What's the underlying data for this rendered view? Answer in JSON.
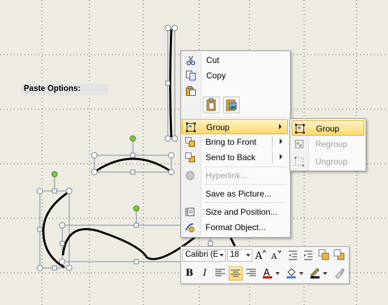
{
  "context_menu": {
    "items": [
      {
        "label": "Cut",
        "icon": "scissors-icon",
        "disabled": false
      },
      {
        "label": "Copy",
        "icon": "copy-icon",
        "disabled": false
      },
      {
        "label": "Group",
        "icon": "group-icon",
        "disabled": false,
        "submenu": true,
        "highlighted": true
      },
      {
        "label": "Bring to Front",
        "icon": "bring-to-front-icon",
        "disabled": false,
        "submenu": true
      },
      {
        "label": "Send to Back",
        "icon": "send-to-back-icon",
        "disabled": false,
        "submenu": true
      },
      {
        "label": "Hyperlink...",
        "icon": "hyperlink-icon",
        "disabled": true
      },
      {
        "label": "Save as Picture...",
        "icon": "",
        "disabled": false
      },
      {
        "label": "Size and Position...",
        "icon": "size-position-icon",
        "disabled": false
      },
      {
        "label": "Format Object...",
        "icon": "format-object-icon",
        "disabled": false
      }
    ],
    "paste_options_label": "Paste Options:",
    "paste_options": [
      "paste-keep-formatting-icon",
      "paste-picture-icon"
    ]
  },
  "group_submenu": {
    "items": [
      {
        "label": "Group",
        "icon": "group-icon",
        "disabled": false,
        "highlighted": true
      },
      {
        "label": "Regroup",
        "icon": "regroup-icon",
        "disabled": true
      },
      {
        "label": "Ungroup",
        "icon": "ungroup-icon",
        "disabled": true
      }
    ]
  },
  "mini_toolbar": {
    "font_name": "Calibri (E",
    "font_size": "18",
    "colors": {
      "font_color": "#c00000",
      "fill_color": "#4f81bd",
      "line_color": "#000000"
    }
  },
  "colors": {
    "background": "#eeebe2",
    "highlight": "#ffd96b",
    "handle": "#7dc242"
  }
}
